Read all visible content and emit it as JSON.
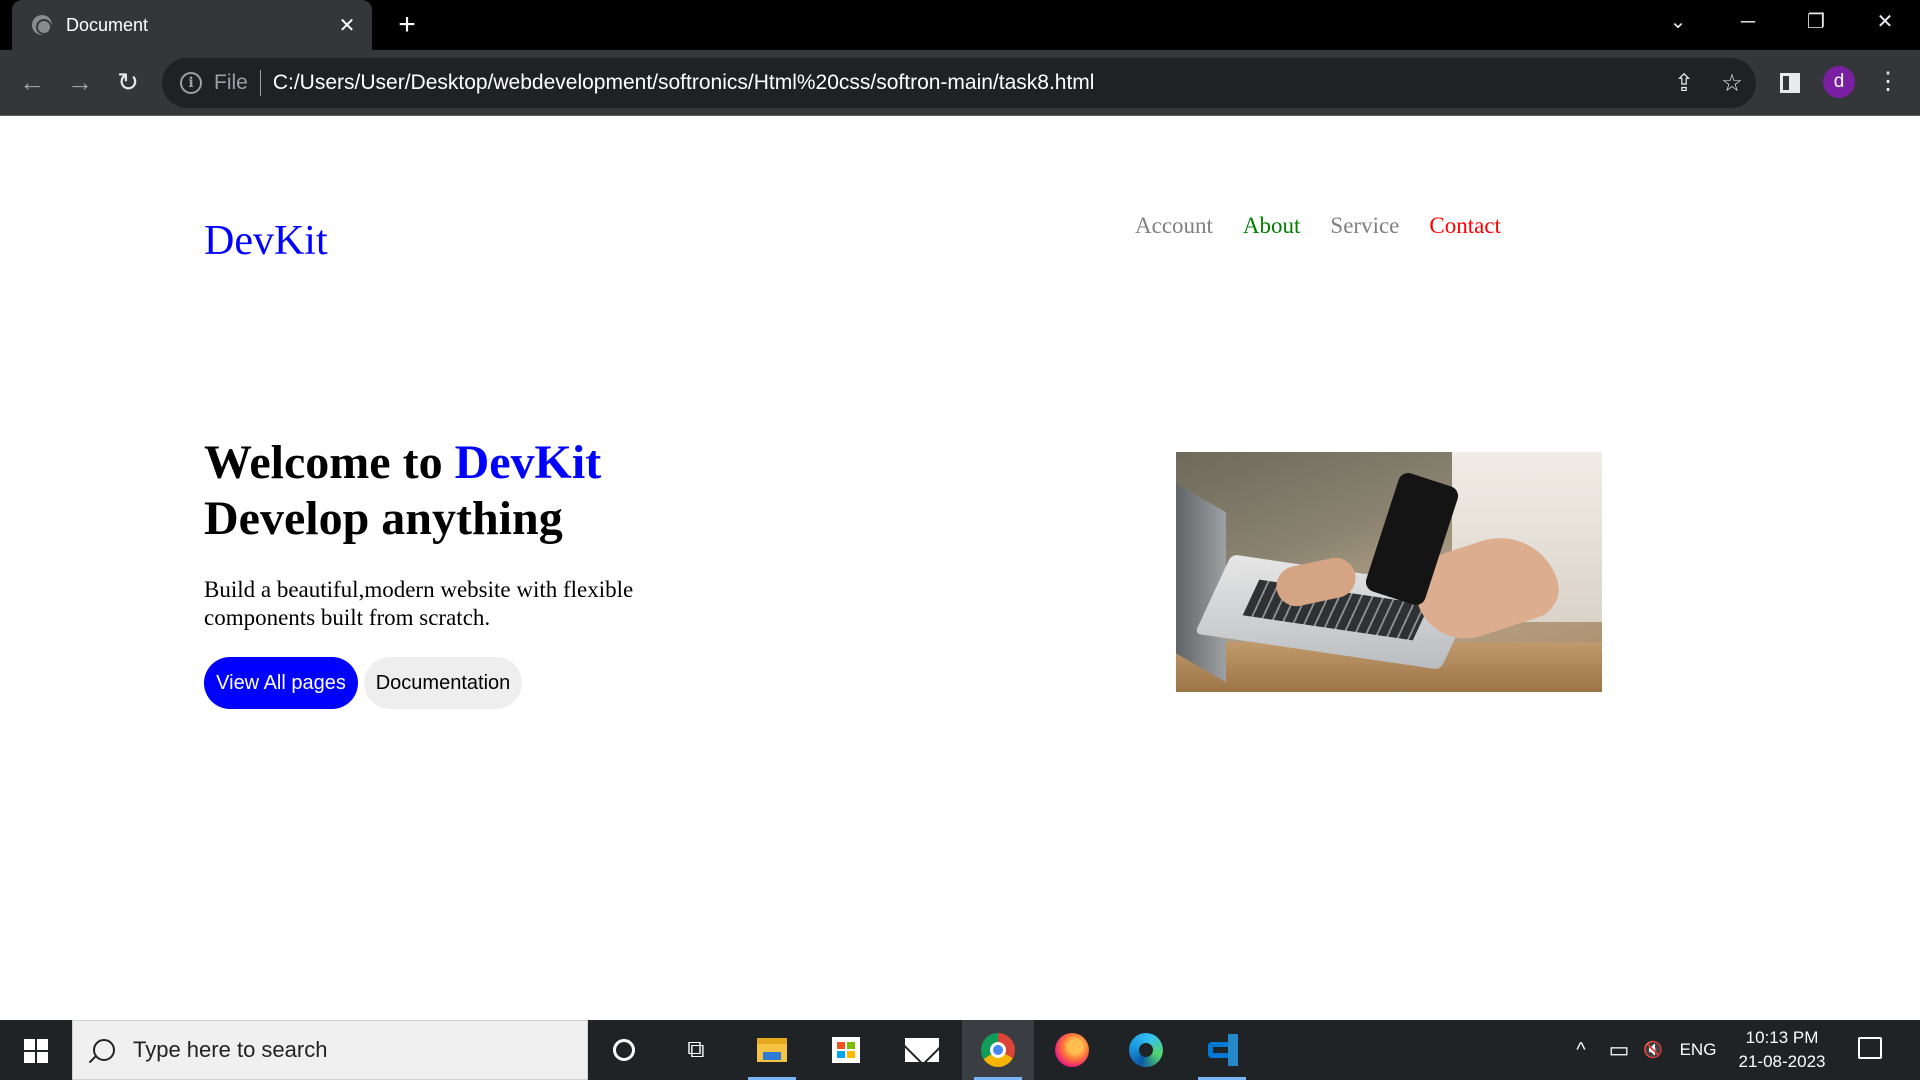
{
  "browser": {
    "tab_title": "Document",
    "tab_close": "✕",
    "new_tab": "+",
    "window_controls": {
      "tab_search": "⌄",
      "minimize": "─",
      "restore": "❐",
      "close": "✕"
    },
    "nav": {
      "back": "←",
      "forward": "→",
      "reload": "↻"
    },
    "address": {
      "info": "i",
      "scheme": "File",
      "url": "C:/Users/User/Desktop/webdevelopment/softronics/Html%20css/softron-main/task8.html"
    },
    "toolbar": {
      "share": "⇪",
      "bookmark": "☆",
      "menu": "⋮"
    },
    "profile_initial": "d"
  },
  "page": {
    "logo": "DevKit",
    "nav_items": [
      {
        "label": "Account",
        "color": "#808080"
      },
      {
        "label": "About",
        "color": "#008000"
      },
      {
        "label": "Service",
        "color": "#808080"
      },
      {
        "label": "Contact",
        "color": "#ff0000"
      }
    ],
    "hero": {
      "title_prefix": "Welcome to ",
      "title_brand": "DevKit",
      "title_line2": "Develop anything",
      "description": "Build a beautiful,modern website with flexible components built from scratch.",
      "primary_button": "View All pages",
      "secondary_button": "Documentation",
      "image_icon": "laptop-phone-photo"
    },
    "colors": {
      "brand": "#0000ff",
      "primary_button_bg": "#0000ff",
      "secondary_button_bg": "#eeeeee"
    }
  },
  "taskbar": {
    "search_placeholder": "Type here to search",
    "apps": [
      "cortana-icon",
      "task-view-icon",
      "file-explorer-icon",
      "store-icon",
      "mail-icon",
      "chrome-icon",
      "firefox-icon",
      "edge-icon",
      "vscode-icon"
    ],
    "tray": {
      "chevron": "^",
      "battery": "▭",
      "volume": "🔇",
      "language": "ENG"
    },
    "time": "10:13 PM",
    "date": "21-08-2023"
  }
}
